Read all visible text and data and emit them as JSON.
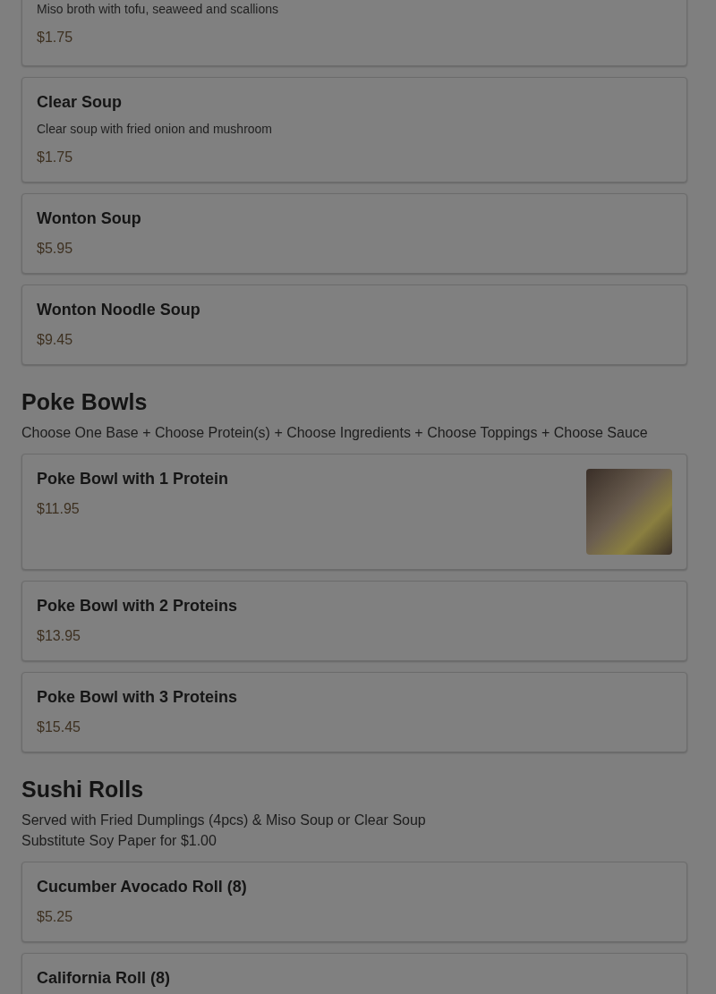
{
  "sections": [
    {
      "items": [
        {
          "description": "Miso broth with tofu, seaweed and scallions",
          "price": "$1.75",
          "photo": false
        },
        {
          "name": "Clear Soup",
          "description": "Clear soup with fried onion and mushroom",
          "price": "$1.75",
          "photo": false
        },
        {
          "name": "Wonton Soup",
          "price": "$5.95",
          "photo": false
        },
        {
          "name": "Wonton Noodle Soup",
          "price": "$9.45",
          "photo": false
        }
      ]
    },
    {
      "title": "Poke Bowls",
      "notes": [
        "Choose One Base + Choose Protein(s) + Choose Ingredients + Choose Toppings + Choose Sauce"
      ],
      "items": [
        {
          "name": "Poke Bowl with 1 Protein",
          "price": "$11.95",
          "photo": true
        },
        {
          "name": "Poke Bowl with 2 Proteins",
          "price": "$13.95",
          "photo": false
        },
        {
          "name": "Poke Bowl with 3 Proteins",
          "price": "$15.45",
          "photo": false
        }
      ]
    },
    {
      "title": "Sushi Rolls",
      "notes": [
        "Served with Fried Dumplings (4pcs) & Miso Soup or Clear Soup",
        "Substitute Soy Paper for $1.00"
      ],
      "items": [
        {
          "name": "Cucumber Avocado Roll (8)",
          "price": "$5.25",
          "photo": false
        },
        {
          "name": "California Roll (8)",
          "photo": false
        }
      ]
    }
  ]
}
